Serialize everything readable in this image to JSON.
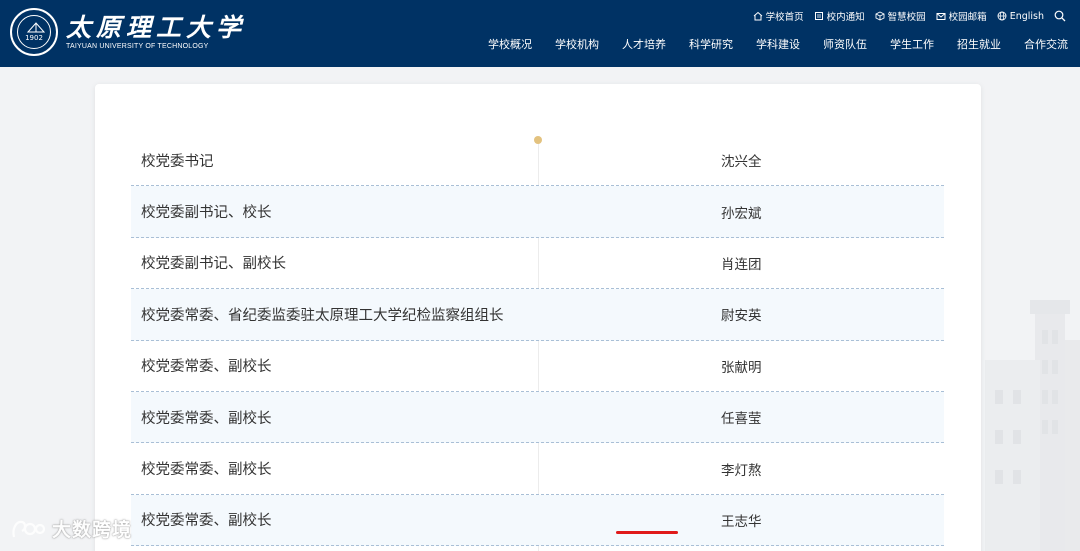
{
  "header": {
    "logo_cn": "太原理工大学",
    "logo_en": "TAIYUAN UNIVERSITY OF TECHNOLOGY",
    "seal_year": "1902",
    "brand_color": "#003264",
    "top_links": [
      {
        "label": "学校首页",
        "icon": "home-icon"
      },
      {
        "label": "校内通知",
        "icon": "notice-icon"
      },
      {
        "label": "智慧校园",
        "icon": "cube-icon"
      },
      {
        "label": "校园邮箱",
        "icon": "mail-icon"
      },
      {
        "label": "English",
        "icon": "globe-icon"
      }
    ],
    "search_icon": "search-icon",
    "nav": [
      "学校概况",
      "学校机构",
      "人才培养",
      "科学研究",
      "学科建设",
      "师资队伍",
      "学生工作",
      "招生就业",
      "合作交流"
    ]
  },
  "leaders": [
    {
      "title": "校党委书记",
      "name": "沈兴全"
    },
    {
      "title": "校党委副书记、校长",
      "name": "孙宏斌"
    },
    {
      "title": "校党委副书记、副校长",
      "name": "肖连团"
    },
    {
      "title": "校党委常委、省纪委监委驻太原理工大学纪检监察组组长",
      "name": "尉安英"
    },
    {
      "title": "校党委常委、副校长",
      "name": "张献明"
    },
    {
      "title": "校党委常委、副校长",
      "name": "任喜莹"
    },
    {
      "title": "校党委常委、副校长",
      "name": "李灯熬"
    },
    {
      "title": "校党委常委、副校长",
      "name": "王志华"
    }
  ],
  "highlight_color": "#e01a1a",
  "accent_dot_color": "#e3c27f",
  "watermark": "大数跨境"
}
